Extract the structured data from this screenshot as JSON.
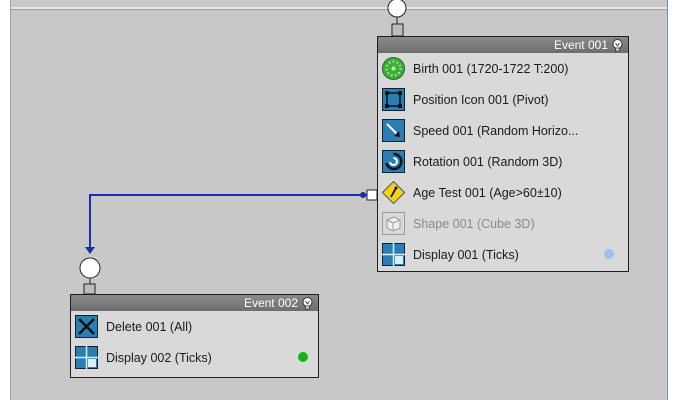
{
  "event1": {
    "title": "Event 001",
    "operators": [
      {
        "label": "Birth 001 (1720-1722 T:200)",
        "icon": "birth-icon",
        "enabled": true
      },
      {
        "label": "Position Icon 001 (Pivot)",
        "icon": "position-icon",
        "enabled": true
      },
      {
        "label": "Speed 001 (Random Horizo...",
        "icon": "speed-icon",
        "enabled": true
      },
      {
        "label": "Rotation 001 (Random 3D)",
        "icon": "rotation-icon",
        "enabled": true
      },
      {
        "label": "Age Test 001 (Age>60±10)",
        "icon": "age-test-icon",
        "enabled": true
      },
      {
        "label": "Shape 001 (Cube 3D)",
        "icon": "shape-icon",
        "enabled": false
      },
      {
        "label": "Display 001 (Ticks)",
        "icon": "display-icon",
        "enabled": true
      }
    ],
    "display_color": "#9ac1ef"
  },
  "event2": {
    "title": "Event 002",
    "operators": [
      {
        "label": "Delete 001 (All)",
        "icon": "delete-icon",
        "enabled": true
      },
      {
        "label": "Display 002 (Ticks)",
        "icon": "display-icon",
        "enabled": true
      }
    ],
    "display_color": "#12b312"
  },
  "colors": {
    "canvas": "#c8c8c8",
    "wire": "#1a2fa8",
    "header": "#7a7a7a"
  }
}
